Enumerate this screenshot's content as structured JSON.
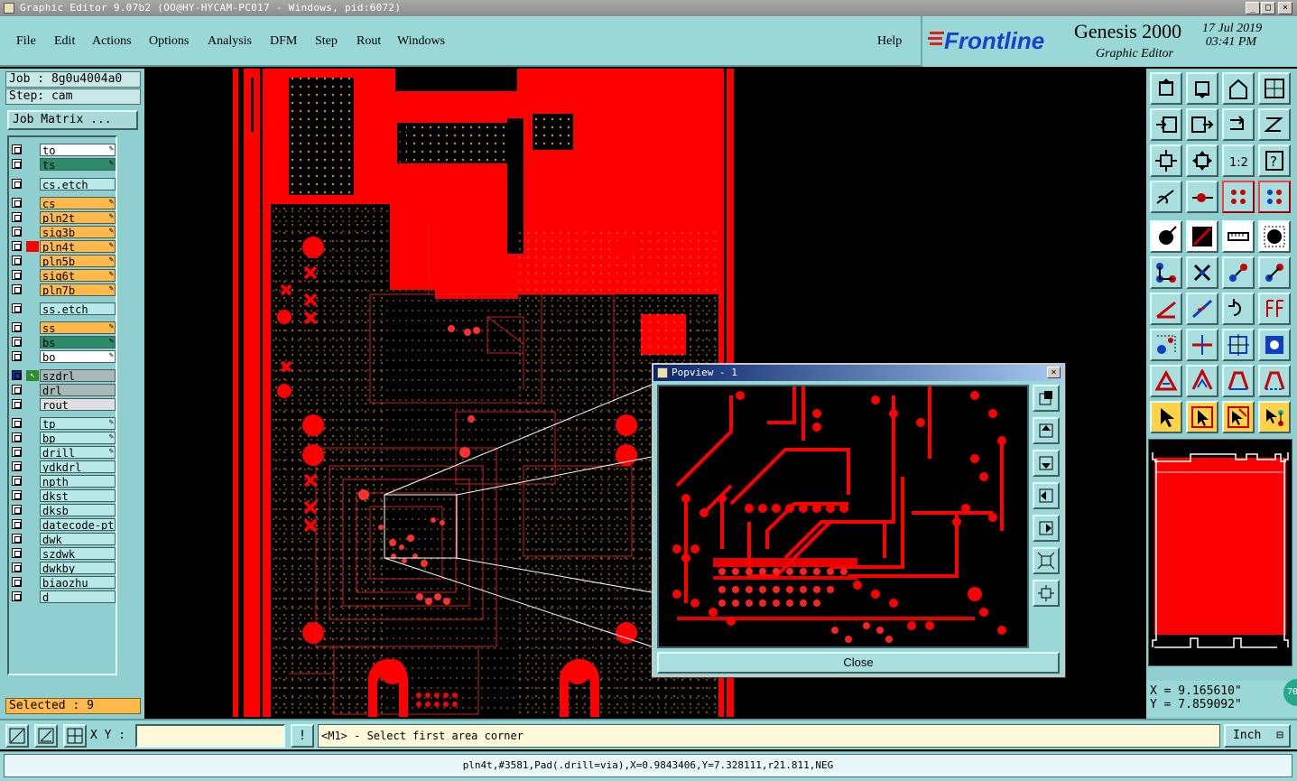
{
  "window": {
    "title": "Graphic Editor 9.07b2 (OO@HY-HYCAM-PC017 - Windows, pid:6072)",
    "minimize": "_",
    "maximize": "□",
    "close": "×"
  },
  "menu": {
    "items": [
      "File",
      "Edit",
      "Actions",
      "Options",
      "Analysis",
      "DFM",
      "Step",
      "Rout",
      "Windows"
    ],
    "help": "Help"
  },
  "brand": {
    "logo": "Frontline",
    "product": "Genesis 2000",
    "subtitle": "Graphic Editor",
    "date": "17 Jul 2019",
    "time": "03:41 PM",
    "logo_color": "#1a3fc8"
  },
  "job": {
    "job": "Job : 8g0u4004a0",
    "step": "Step: cam",
    "matrix_button": "Job Matrix ..."
  },
  "layers": [
    {
      "name": "to",
      "color": "#ffffff",
      "edit": true
    },
    {
      "name": "ts",
      "color": "#2e8b6a",
      "edit": true
    },
    {
      "name": "cs.etch",
      "color": "#b8e8e8",
      "edit": false
    },
    {
      "name": "cs",
      "color": "#ffb84a",
      "edit": true
    },
    {
      "name": "pln2t",
      "color": "#ffb84a",
      "edit": true
    },
    {
      "name": "sig3b",
      "color": "#ffb84a",
      "edit": true
    },
    {
      "name": "pln4t",
      "color": "#ffb84a",
      "edit": true,
      "active": true
    },
    {
      "name": "pln5b",
      "color": "#ffb84a",
      "edit": true
    },
    {
      "name": "sig6t",
      "color": "#ffb84a",
      "edit": true
    },
    {
      "name": "pln7b",
      "color": "#ffb84a",
      "edit": true
    },
    {
      "name": "ss.etch",
      "color": "#b8e8e8",
      "edit": false
    },
    {
      "name": "ss",
      "color": "#ffb84a",
      "edit": true
    },
    {
      "name": "bs",
      "color": "#2e8b6a",
      "edit": true
    },
    {
      "name": "bo",
      "color": "#ffffff",
      "edit": true
    },
    {
      "name": "szdrl",
      "color": "#a8b8b8",
      "edit": false,
      "work": true
    },
    {
      "name": "drl",
      "color": "#a8b8b8",
      "edit": false
    },
    {
      "name": "rout",
      "color": "#e0e0e0",
      "edit": false
    },
    {
      "name": "tp",
      "color": "#b8e8e8",
      "edit": true
    },
    {
      "name": "bp",
      "color": "#b8e8e8",
      "edit": true
    },
    {
      "name": "drill",
      "color": "#b8e8e8",
      "edit": true
    },
    {
      "name": "ydkdrl",
      "color": "#b8e8e8",
      "edit": false
    },
    {
      "name": "npth",
      "color": "#b8e8e8",
      "edit": false
    },
    {
      "name": "dkst",
      "color": "#b8e8e8",
      "edit": false
    },
    {
      "name": "dksb",
      "color": "#b8e8e8",
      "edit": false
    },
    {
      "name": "datecode-pte",
      "color": "#b8e8e8",
      "edit": false
    },
    {
      "name": "dwk",
      "color": "#b8e8e8",
      "edit": false
    },
    {
      "name": "szdwk",
      "color": "#b8e8e8",
      "edit": false
    },
    {
      "name": "dwkby",
      "color": "#b8e8e8",
      "edit": false
    },
    {
      "name": "biaozhu",
      "color": "#b8e8e8",
      "edit": false
    },
    {
      "name": "d",
      "color": "#b8e8e8",
      "edit": false
    }
  ],
  "selected": "Selected : 9",
  "popview": {
    "title": "Popview - 1",
    "close_button": "Close"
  },
  "coords": {
    "x": "X = 9.165610\"",
    "y": "Y = 7.859092\"",
    "badge": "70"
  },
  "bottom": {
    "xy_label": "X Y :",
    "xy_value": "",
    "info_button": "!",
    "prompt": "<M1> - Select first area corner",
    "unit": "Inch"
  },
  "status": "pln4t,#3581,Pad(.drill=via),X=0.9843406,Y=7.328111,r21.811,NEG",
  "colors": {
    "board_red": "#ff0000",
    "pad_orange": "#d89020",
    "panel_teal": "#9ad8d8",
    "highlight": "#ffb84a"
  }
}
